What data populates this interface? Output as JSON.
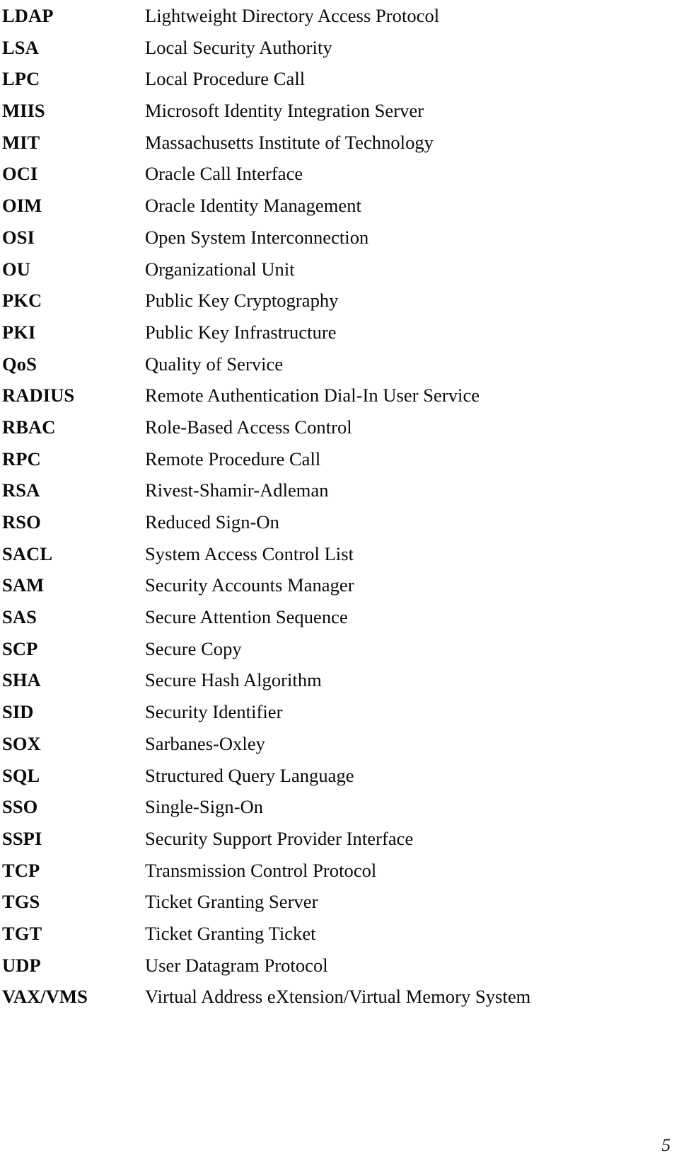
{
  "page": {
    "page_number": "5",
    "columns": {
      "abbreviation_header": "",
      "expansion_header": ""
    },
    "entries": [
      {
        "abbr": "LDAP",
        "expansion": "Lightweight Directory Access Protocol"
      },
      {
        "abbr": "LSA",
        "expansion": "Local Security Authority"
      },
      {
        "abbr": "LPC",
        "expansion": "Local Procedure Call"
      },
      {
        "abbr": "MIIS",
        "expansion": "Microsoft Identity Integration Server"
      },
      {
        "abbr": "MIT",
        "expansion": "Massachusetts Institute of Technology"
      },
      {
        "abbr": "OCI",
        "expansion": "Oracle Call Interface"
      },
      {
        "abbr": "OIM",
        "expansion": "Oracle Identity Management"
      },
      {
        "abbr": "OSI",
        "expansion": "Open System Interconnection"
      },
      {
        "abbr": "OU",
        "expansion": "Organizational Unit"
      },
      {
        "abbr": "PKC",
        "expansion": "Public Key Cryptography"
      },
      {
        "abbr": "PKI",
        "expansion": "Public Key Infrastructure"
      },
      {
        "abbr": "QoS",
        "expansion": "Quality of Service"
      },
      {
        "abbr": "RADIUS",
        "expansion": "Remote Authentication Dial-In User Service"
      },
      {
        "abbr": "RBAC",
        "expansion": "Role-Based Access Control"
      },
      {
        "abbr": "RPC",
        "expansion": "Remote Procedure Call"
      },
      {
        "abbr": "RSA",
        "expansion": "Rivest-Shamir-Adleman"
      },
      {
        "abbr": "RSO",
        "expansion": "Reduced Sign-On"
      },
      {
        "abbr": "SACL",
        "expansion": "System Access Control List"
      },
      {
        "abbr": "SAM",
        "expansion": "Security Accounts Manager"
      },
      {
        "abbr": "SAS",
        "expansion": "Secure Attention Sequence"
      },
      {
        "abbr": "SCP",
        "expansion": "Secure Copy"
      },
      {
        "abbr": "SHA",
        "expansion": "Secure Hash Algorithm"
      },
      {
        "abbr": "SID",
        "expansion": "Security Identifier"
      },
      {
        "abbr": "SOX",
        "expansion": "Sarbanes-Oxley"
      },
      {
        "abbr": "SQL",
        "expansion": "Structured Query Language"
      },
      {
        "abbr": "SSO",
        "expansion": "Single-Sign-On"
      },
      {
        "abbr": "SSPI",
        "expansion": "Security Support Provider Interface"
      },
      {
        "abbr": "TCP",
        "expansion": "Transmission Control Protocol"
      },
      {
        "abbr": "TGS",
        "expansion": "Ticket Granting Server"
      },
      {
        "abbr": "TGT",
        "expansion": "Ticket Granting Ticket"
      },
      {
        "abbr": "UDP",
        "expansion": "User Datagram Protocol"
      },
      {
        "abbr": "VAX/VMS",
        "expansion": "Virtual Address eXtension/Virtual Memory System"
      }
    ]
  }
}
